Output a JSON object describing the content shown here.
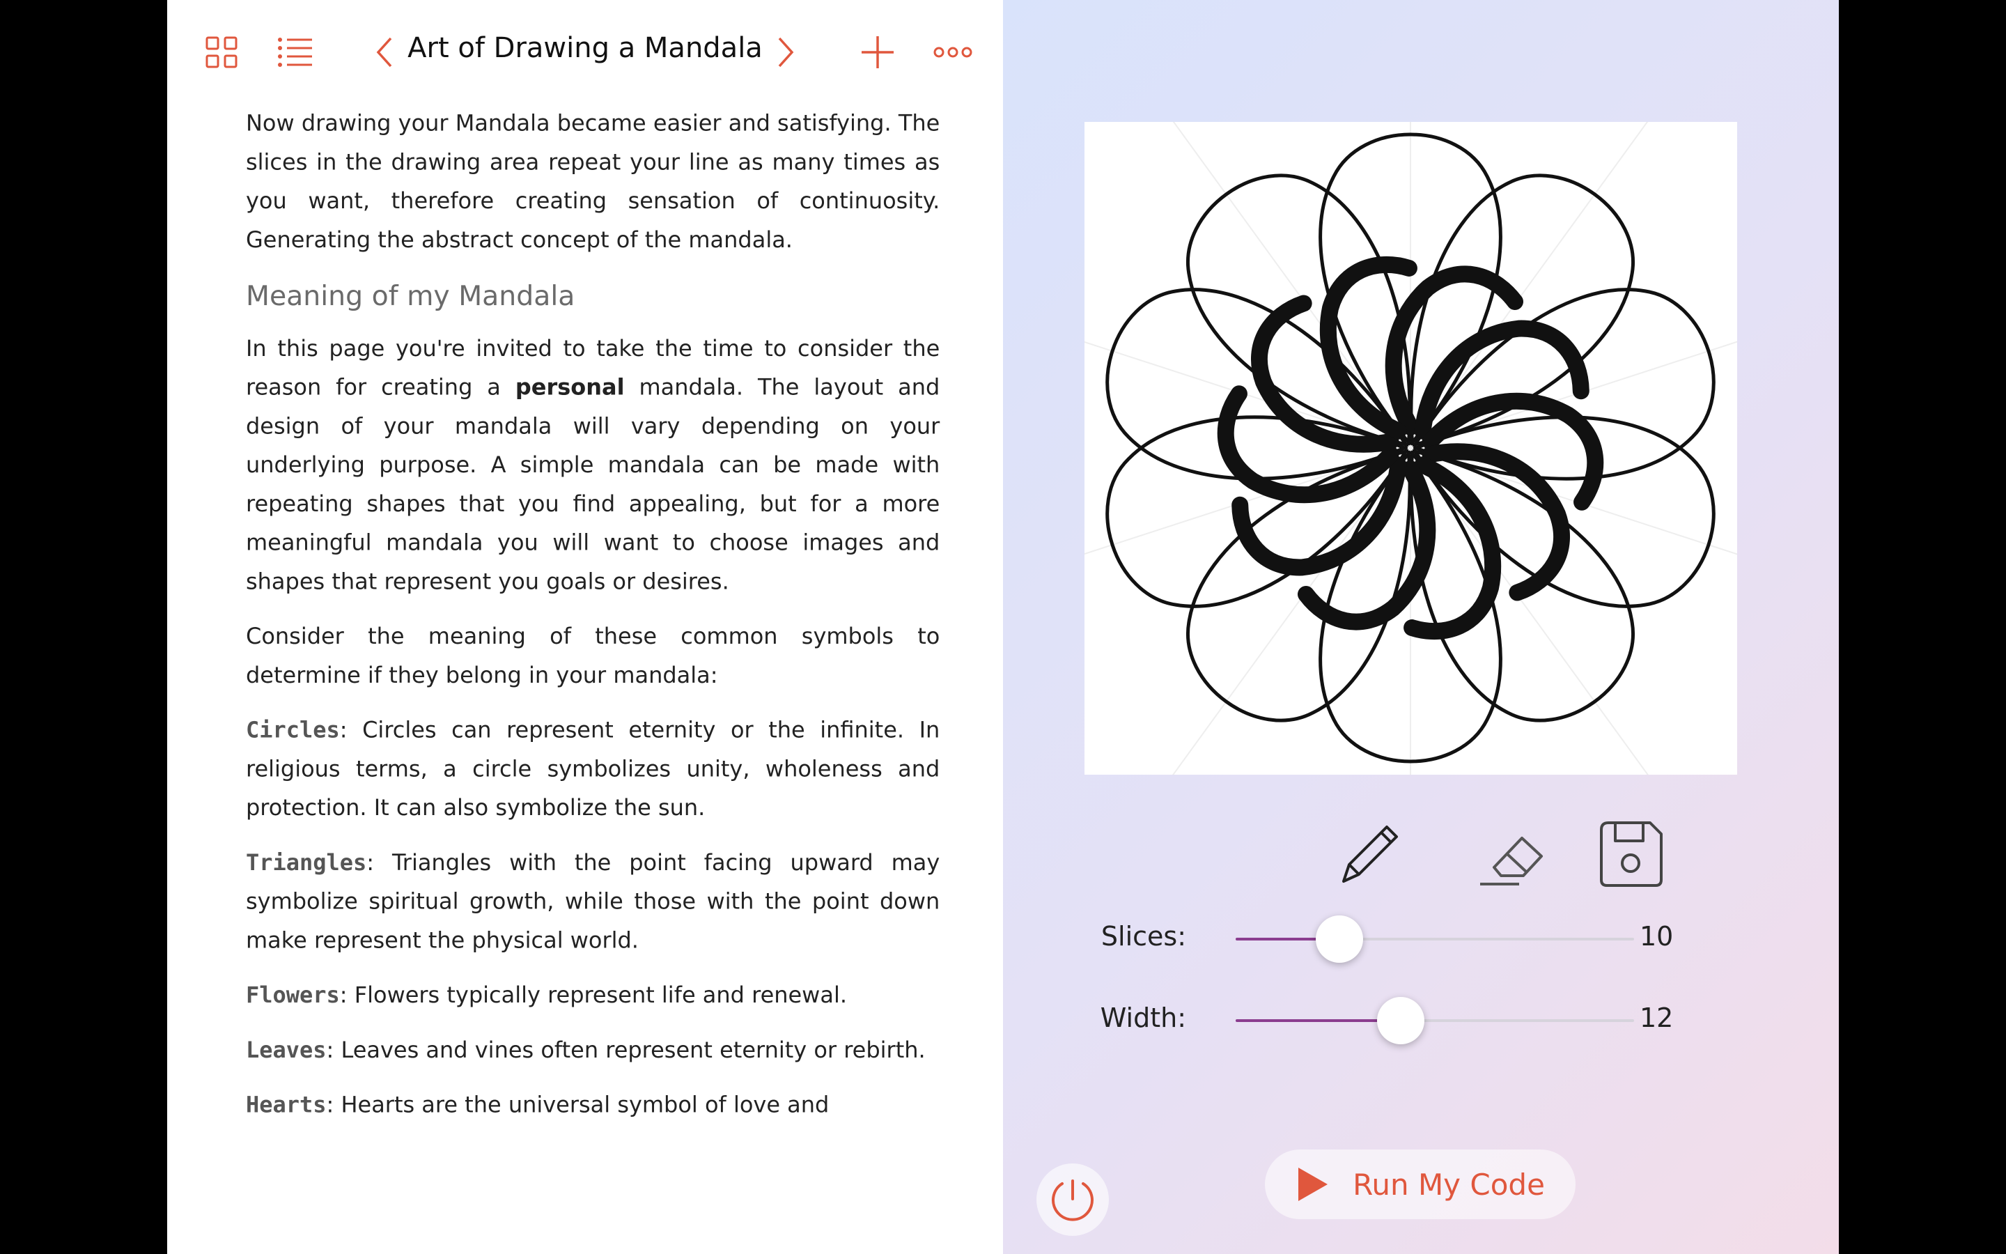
{
  "toolbar": {
    "title": "Art of Drawing a Mandala",
    "icons": [
      "grid-icon",
      "list-icon",
      "chevron-left-icon",
      "chevron-right-icon",
      "plus-icon",
      "more-icon"
    ],
    "accent": "#e0573d"
  },
  "document": {
    "intro": "Now drawing your Mandala became easier and satisfying. The slices in the drawing area repeat your line as many times as you want, therefore creating sensation of continuosity. Generating the abstract concept of the mandala.",
    "heading": "Meaning of my Mandala",
    "para2_before": "In this page you're invited to take the time to consider the reason for creating a ",
    "para2_bold": "personal",
    "para2_after": " mandala. The layout and design of your mandala will vary depending on your underlying purpose. A simple mandala can be made with repeating shapes that you find appealing, but for a more meaningful mandala you will want to choose images and shapes that represent you goals or desires.",
    "para3": "Consider the meaning of these common symbols to determine if they belong in your mandala:",
    "symbols": [
      {
        "name": "Circles",
        "text": ": Circles can represent eternity or the infinite. In religious terms, a circle symbolizes unity, wholeness and protection. It can also symbolize the sun."
      },
      {
        "name": "Triangles",
        "text": ": Triangles with the point facing upward may symbolize spiritual growth, while those with the point down make represent the physical world."
      },
      {
        "name": "Flowers",
        "text": ": Flowers typically represent life and renewal."
      },
      {
        "name": "Leaves",
        "text": ": Leaves and vines often represent eternity or rebirth."
      },
      {
        "name": "Hearts",
        "text": ": Hearts are the universal symbol of love and"
      }
    ]
  },
  "live_view": {
    "tools": [
      "pencil-icon",
      "eraser-icon",
      "save-icon"
    ],
    "slices": {
      "label": "Slices:",
      "value": "10",
      "fraction": 0.26
    },
    "width": {
      "label": "Width:",
      "value": "12",
      "fraction": 0.415
    },
    "slider_color": "#8b3d8f",
    "run_label": "Run My Code",
    "timer_icon": "timer-icon"
  }
}
